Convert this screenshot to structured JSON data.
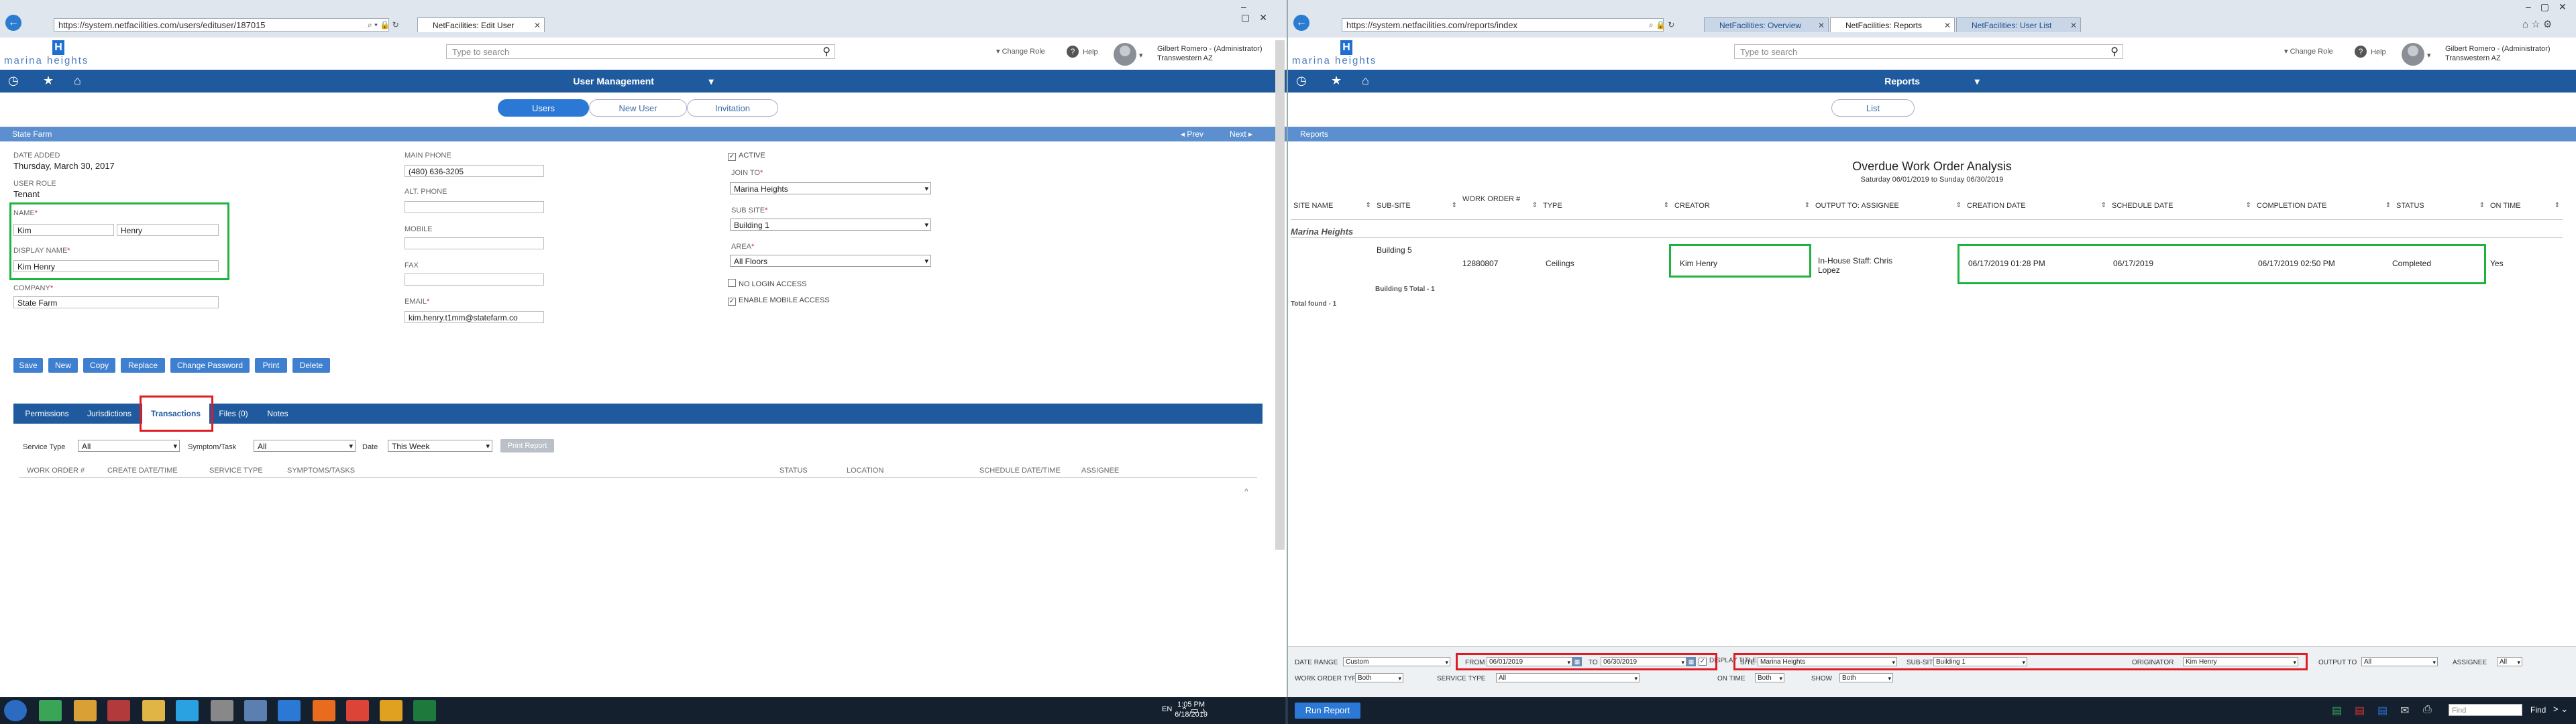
{
  "left_window": {
    "url": "https://system.netfacilities.com/users/edituser/187015",
    "tabs": [
      {
        "label": "NetFacilities: Edit User",
        "active": true
      }
    ],
    "background_tabs": [
      "",
      "",
      "",
      "",
      ""
    ],
    "search_placeholder": "Type to search",
    "change_role": "Change Role",
    "help": "Help",
    "user_name": "Gilbert Romero - (Administrator)",
    "user_org": "Transwestern AZ",
    "logo_text": "marina heights",
    "section_title": "User Management",
    "subtabs": [
      "Users",
      "New User",
      "Invitation"
    ],
    "active_subtab": "Users",
    "record_bar": {
      "title": "State Farm",
      "prev": "Prev",
      "next": "Next"
    },
    "date_added_label": "DATE ADDED",
    "date_added": "Thursday, March 30, 2017",
    "user_role_label": "USER ROLE",
    "user_role": "Tenant",
    "name_label": "NAME",
    "first_name": "Kim",
    "last_name": "Henry",
    "display_name_label": "DISPLAY NAME",
    "display_name": "Kim Henry",
    "company_label": "COMPANY",
    "company": "State Farm",
    "main_phone_label": "MAIN PHONE",
    "main_phone": "(480) 636-3205",
    "alt_phone_label": "ALT. PHONE",
    "mobile_label": "MOBILE",
    "fax_label": "FAX",
    "email_label": "EMAIL",
    "email": "kim.henry.t1mm@statefarm.co",
    "active_label": "ACTIVE",
    "join_to_label": "JOIN TO",
    "join_to": "Marina Heights",
    "sub_site_label": "SUB SITE",
    "sub_site": "Building 1",
    "area_label": "AREA",
    "area": "All Floors",
    "no_login_label": "NO LOGIN ACCESS",
    "mobile_access_label": "ENABLE MOBILE ACCESS",
    "buttons": [
      "Save",
      "New",
      "Copy",
      "Replace",
      "Change Password",
      "Print",
      "Delete"
    ],
    "detail_tabs": [
      "Permissions",
      "Jurisdictions",
      "Transactions",
      "Files (0)",
      "Notes"
    ],
    "active_detail_tab": "Transactions",
    "filters": {
      "service_type_label": "Service Type",
      "service_type": "All",
      "symptom_label": "Symptom/Task",
      "symptom": "All",
      "date_label": "Date",
      "date": "This Week",
      "print_report": "Print Report"
    },
    "transaction_columns": [
      "WORK ORDER #",
      "CREATE DATE/TIME",
      "SERVICE TYPE",
      "SYMPTOMS/TASKS",
      "STATUS",
      "LOCATION",
      "SCHEDULE DATE/TIME",
      "ASSIGNEE"
    ]
  },
  "right_window": {
    "url": "https://system.netfacilities.com/reports/index",
    "tabs": [
      {
        "label": "NetFacilities: Overview",
        "active": false
      },
      {
        "label": "NetFacilities: Reports",
        "active": true
      },
      {
        "label": "NetFacilities: User List",
        "active": false
      }
    ],
    "search_placeholder": "Type to search",
    "change_role": "Change Role",
    "help": "Help",
    "user_name": "Gilbert Romero - (Administrator)",
    "user_org": "Transwestern AZ",
    "logo_text": "marina heights",
    "section_title": "Reports",
    "subtabs": [
      "List"
    ],
    "reports_bar": "Reports",
    "report_title": "Overdue Work Order Analysis",
    "report_subtitle": "Saturday 06/01/2019 to Sunday 06/30/2019",
    "columns": [
      "SITE NAME",
      "SUB-SITE",
      "WORK ORDER #",
      "TYPE",
      "CREATOR",
      "OUTPUT TO: ASSIGNEE",
      "CREATION DATE",
      "SCHEDULE DATE",
      "COMPLETION DATE",
      "STATUS",
      "ON TIME"
    ],
    "group_site": "Marina Heights",
    "group_subsite": "Building 5",
    "row": {
      "work_order": "12880807",
      "type": "Ceilings",
      "creator": "Kim Henry",
      "assignee": "In-House Staff: Chris Lopez",
      "creation_date": "06/17/2019 01:28 PM",
      "schedule_date": "06/17/2019",
      "completion_date": "06/17/2019 02:50 PM",
      "status": "Completed",
      "on_time": "Yes"
    },
    "subtotal": "Building 5 Total - 1",
    "total": "Total found - 1",
    "params": {
      "date_range_label": "DATE RANGE",
      "date_range": "Custom",
      "from_label": "FROM",
      "from": "06/01/2019",
      "to_label": "TO",
      "to": "06/30/2019",
      "display_title_label": "DISPLAY TITLE",
      "site_label": "SITE",
      "site": "Marina Heights",
      "subsite_label": "SUB-SITE",
      "subsite": "Building 1",
      "originator_label": "ORIGINATOR",
      "originator": "Kim Henry",
      "output_to_label": "OUTPUT TO",
      "output_to": "All",
      "assignee_label": "ASSIGNEE",
      "assignee": "All",
      "wo_type_label": "WORK ORDER TYPE",
      "wo_type": "Both",
      "service_type_label": "SERVICE TYPE",
      "service_type": "All",
      "on_time_label": "ON TIME",
      "on_time": "Both",
      "show_label": "SHOW",
      "show": "Both"
    },
    "run_report": "Run Report",
    "find_placeholder": "Find",
    "find": "Find"
  },
  "taskbar": {
    "lang": "EN",
    "time": "1:05 PM",
    "date": "6/18/2019"
  },
  "colors": {
    "brand_blue": "#1f5a9e",
    "highlight_red": "#e01b24",
    "highlight_green": "#1db33f"
  }
}
